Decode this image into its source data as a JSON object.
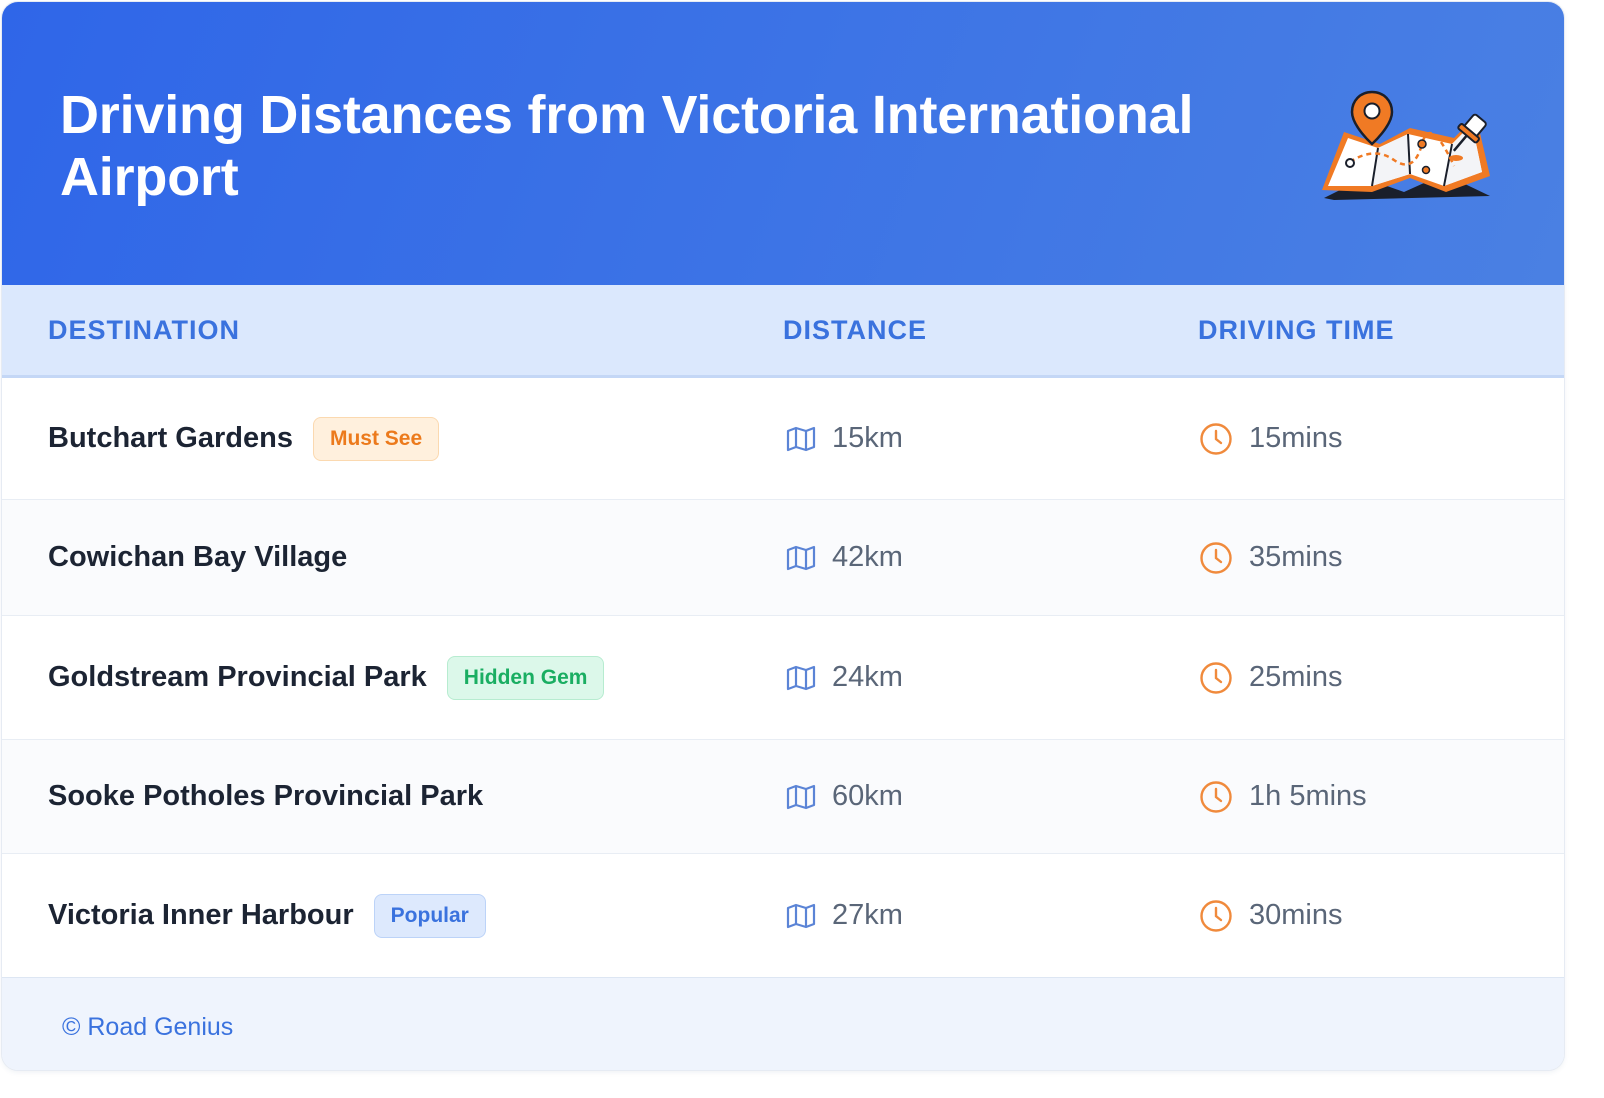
{
  "header": {
    "title": "Driving Distances from Victoria International Airport",
    "illustration_icon": "folded-map-with-pin-icon"
  },
  "table": {
    "columns": [
      "DESTINATION",
      "DISTANCE",
      "DRIVING TIME"
    ],
    "distance_icon": "map-icon",
    "time_icon": "clock-icon",
    "rows": [
      {
        "destination": "Butchart Gardens",
        "badge": "Must See",
        "badge_color": "#ec7a1c",
        "distance": "15km",
        "time": "15mins"
      },
      {
        "destination": "Cowichan Bay Village",
        "badge": "",
        "badge_color": "",
        "distance": "42km",
        "time": "35mins"
      },
      {
        "destination": "Goldstream Provincial Park",
        "badge": "Hidden Gem",
        "badge_color": "#1aae62",
        "distance": "24km",
        "time": "25mins"
      },
      {
        "destination": "Sooke Potholes Provincial Park",
        "badge": "",
        "badge_color": "",
        "distance": "60km",
        "time": "1h 5mins"
      },
      {
        "destination": "Victoria Inner Harbour",
        "badge": "Popular",
        "badge_color": "#3a72de",
        "distance": "27km",
        "time": "30mins"
      }
    ]
  },
  "footer": {
    "credit": "© Road Genius"
  },
  "colors": {
    "header_gradient_start": "#2f66e8",
    "header_gradient_end": "#4a80e3",
    "accent_blue": "#3a72de",
    "clock_orange": "#f08a3c",
    "map_icon_blue": "#5b84d6"
  }
}
